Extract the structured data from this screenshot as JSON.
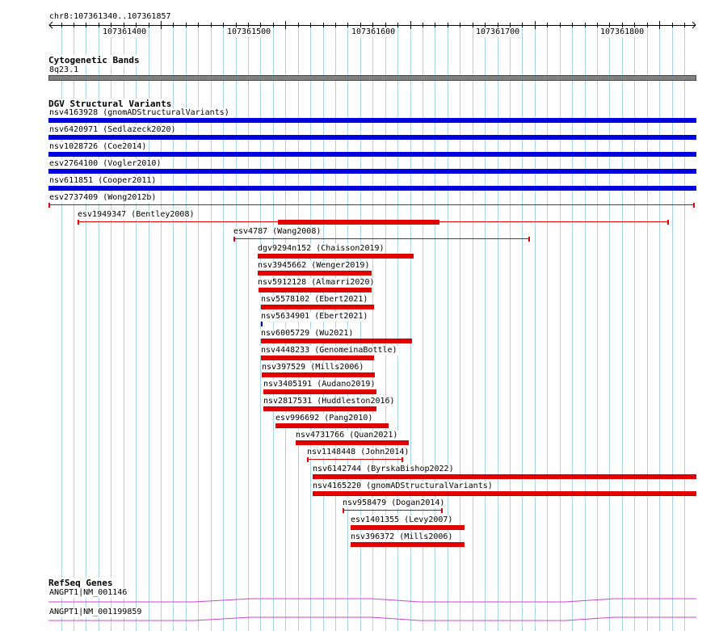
{
  "ruler": {
    "position": "chr8:107361340..107361857",
    "ticks": [
      {
        "label": "107361400",
        "pos": 107361400
      },
      {
        "label": "107361500",
        "pos": 107361500
      },
      {
        "label": "107361600",
        "pos": 107361600
      },
      {
        "label": "107361700",
        "pos": 107361700
      },
      {
        "label": "107361800",
        "pos": 107361800
      }
    ]
  },
  "cytoband": {
    "title": "Cytogenetic Bands",
    "band_label": "8q23.1",
    "color": "#808080"
  },
  "dgv": {
    "title": "DGV Structural Variants",
    "colors": {
      "loss": "#e00000",
      "gain_loss": "#0000e0"
    },
    "variants": [
      {
        "label": "nsv4163928 (gnomADStructuralVariants)",
        "color": "blue",
        "style": "full"
      },
      {
        "label": "nsv6420971 (Sedlazeck2020)",
        "color": "blue",
        "style": "full"
      },
      {
        "label": "nsv1028726 (Coe2014)",
        "color": "blue",
        "style": "full"
      },
      {
        "label": "esv2764100 (Vogler2010)",
        "color": "blue",
        "style": "full"
      },
      {
        "label": "nsv611851 (Cooper2011)",
        "color": "blue",
        "style": "full"
      },
      {
        "label": "esv2737409 (Wong2012b)",
        "color": "red",
        "style": "thin"
      },
      {
        "label": "esv1949347 (Bentley2008)",
        "color": "red",
        "style": "thin-thick"
      },
      {
        "label": "esv4787 (Wang2008)",
        "color": "red",
        "style": "thin"
      },
      {
        "label": "dgv9294n152 (Chaisson2019)",
        "color": "red",
        "style": "thick"
      },
      {
        "label": "nsv3945662 (Wenger2019)",
        "color": "red",
        "style": "thick"
      },
      {
        "label": "nsv5912128 (Almarri2020)",
        "color": "red",
        "style": "thick"
      },
      {
        "label": "nsv5578102 (Ebert2021)",
        "color": "red",
        "style": "thick"
      },
      {
        "label": "nsv5634901 (Ebert2021)",
        "color": "blue",
        "style": "tick"
      },
      {
        "label": "nsv6005729 (Wu2021)",
        "color": "red",
        "style": "thick"
      },
      {
        "label": "nsv4448233 (GenomeinaBottle)",
        "color": "red",
        "style": "thick"
      },
      {
        "label": "nsv397529 (Mills2006)",
        "color": "red",
        "style": "thick"
      },
      {
        "label": "nsv3405191 (Audano2019)",
        "color": "red",
        "style": "thick"
      },
      {
        "label": "nsv2817531 (Huddleston2016)",
        "color": "red",
        "style": "thick"
      },
      {
        "label": "esv996692 (Pang2010)",
        "color": "red",
        "style": "thick"
      },
      {
        "label": "nsv4731766 (Quan2021)",
        "color": "red",
        "style": "thick"
      },
      {
        "label": "nsv1148448 (John2014)",
        "color": "red",
        "style": "thin"
      },
      {
        "label": "nsv6142744 (ByrskaBishop2022)",
        "color": "red",
        "style": "thick"
      },
      {
        "label": "nsv4165220 (gnomADStructuralVariants)",
        "color": "red",
        "style": "thick"
      },
      {
        "label": "nsv958479 (Dogan2014)",
        "color": "red",
        "style": "thin"
      },
      {
        "label": "esv1401355 (Levy2007)",
        "color": "red",
        "style": "thick"
      },
      {
        "label": "nsv396372 (Mills2006)",
        "color": "red",
        "style": "thick"
      }
    ]
  },
  "refseq": {
    "title": "RefSeq Genes",
    "color": "#cc44cc",
    "genes": [
      {
        "label": "ANGPT1|NM_001146"
      },
      {
        "label": "ANGPT1|NM_001199859"
      }
    ]
  }
}
